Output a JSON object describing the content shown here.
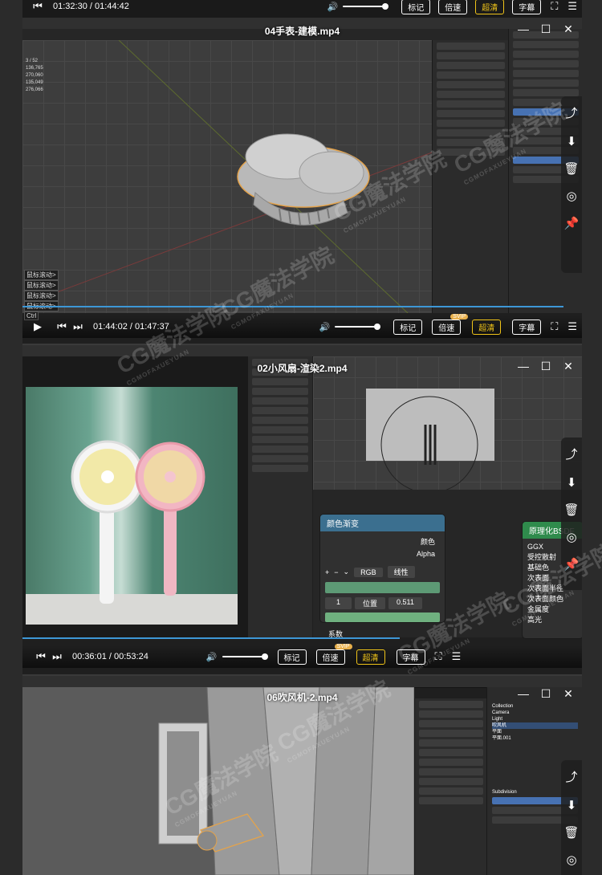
{
  "videos": [
    {
      "title": "04手表-建模.mp4",
      "time_top": "01:32:30 / 01:44:42",
      "time": "01:44:02 / 01:47:37",
      "progress": 0.967,
      "scroll_hints": [
        "鼠标滚动>",
        "鼠标滚动>",
        "鼠标滚动>",
        "鼠标滚动>"
      ],
      "stats": [
        "3 / 52",
        "136,765",
        "270,060",
        "135,049",
        "276,066"
      ],
      "blender_hint": "Ctrl"
    },
    {
      "title": "02小风扇-渲染2.mp4",
      "time": "00:36:01 / 00:53:24",
      "progress": 0.675,
      "node": {
        "title": "颜色渐变",
        "output_color": "颜色",
        "output_alpha": "Alpha",
        "mode": "RGB",
        "interp": "线性",
        "index": "1",
        "pos_label": "位置",
        "pos_value": "0.511",
        "input": "系数"
      },
      "principled": {
        "title": "原理化BSDF",
        "rows": [
          "GGX",
          "受控散射",
          "基础色",
          "次表面",
          "次表面半径",
          "次表面颜色",
          "金属度",
          "高光"
        ]
      }
    },
    {
      "title": "06吹风机-2.mp4",
      "outliner": [
        "Collection",
        "Camera",
        "Light",
        "吹风机",
        "平面",
        "平面.001"
      ],
      "modifier": "Subdivision"
    }
  ],
  "controls": {
    "mark": "标记",
    "speed": "倍速",
    "svip": "SVIP",
    "quality": "超清",
    "subtitle": "字幕"
  },
  "watermark": {
    "text": "CG魔法学院",
    "sub": "CGMOFAXUEYUAN"
  },
  "side_icons": [
    "share-icon",
    "download-icon",
    "trash-icon",
    "target-icon",
    "pin-icon"
  ]
}
